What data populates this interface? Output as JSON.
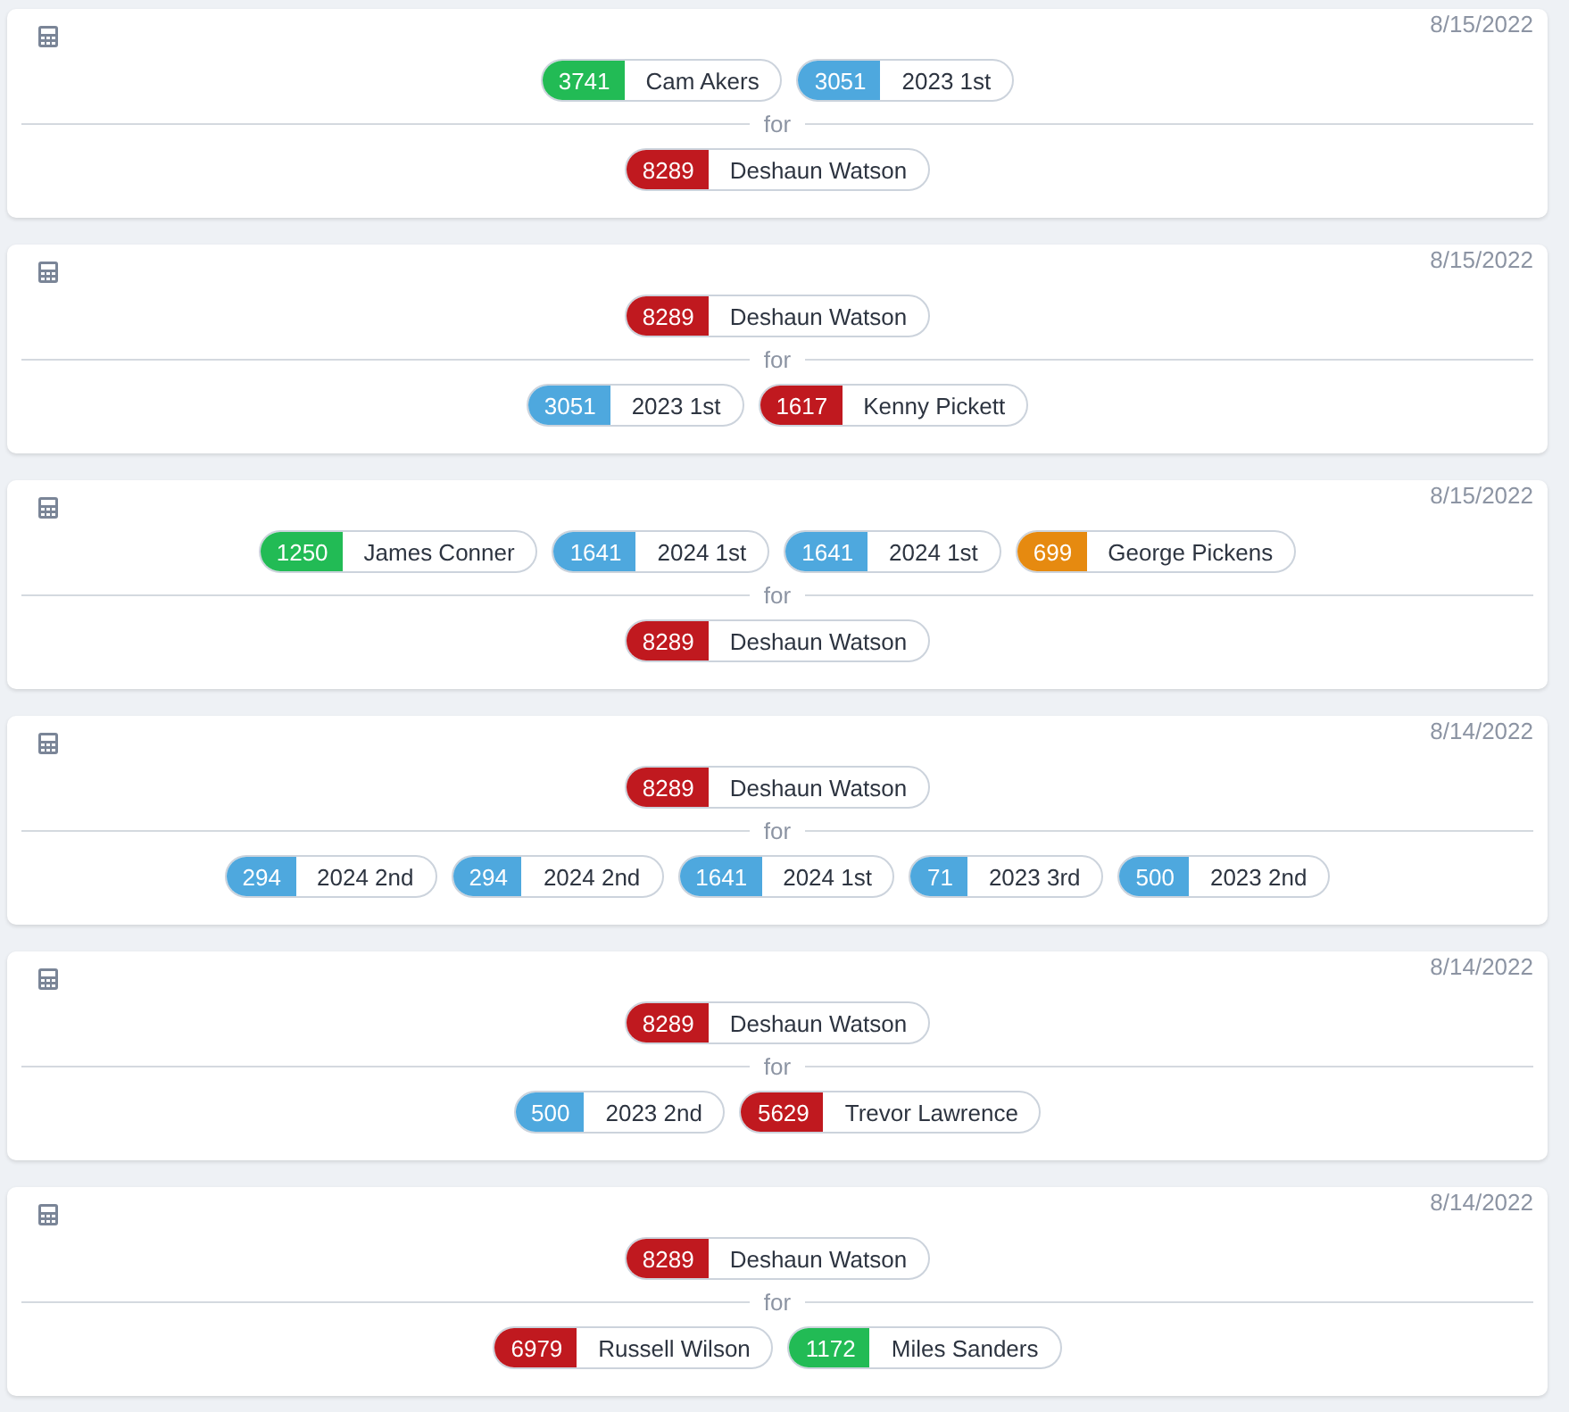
{
  "trades": [
    {
      "date": "8/15/2022",
      "give": [
        {
          "value": "3741",
          "name": "Cam Akers",
          "color": "#22bb55"
        },
        {
          "value": "3051",
          "name": "2023 1st",
          "color": "#4ea8de"
        }
      ],
      "separator": "for",
      "get": [
        {
          "value": "8289",
          "name": "Deshaun Watson",
          "color": "#c0191f"
        }
      ]
    },
    {
      "date": "8/15/2022",
      "give": [
        {
          "value": "8289",
          "name": "Deshaun Watson",
          "color": "#c0191f"
        }
      ],
      "separator": "for",
      "get": [
        {
          "value": "3051",
          "name": "2023 1st",
          "color": "#4ea8de"
        },
        {
          "value": "1617",
          "name": "Kenny Pickett",
          "color": "#c0191f"
        }
      ]
    },
    {
      "date": "8/15/2022",
      "give": [
        {
          "value": "1250",
          "name": "James Conner",
          "color": "#22bb55"
        },
        {
          "value": "1641",
          "name": "2024 1st",
          "color": "#4ea8de"
        },
        {
          "value": "1641",
          "name": "2024 1st",
          "color": "#4ea8de"
        },
        {
          "value": "699",
          "name": "George Pickens",
          "color": "#e68a10"
        }
      ],
      "separator": "for",
      "get": [
        {
          "value": "8289",
          "name": "Deshaun Watson",
          "color": "#c0191f"
        }
      ]
    },
    {
      "date": "8/14/2022",
      "give": [
        {
          "value": "8289",
          "name": "Deshaun Watson",
          "color": "#c0191f"
        }
      ],
      "separator": "for",
      "get": [
        {
          "value": "294",
          "name": "2024 2nd",
          "color": "#4ea8de"
        },
        {
          "value": "294",
          "name": "2024 2nd",
          "color": "#4ea8de"
        },
        {
          "value": "1641",
          "name": "2024 1st",
          "color": "#4ea8de"
        },
        {
          "value": "71",
          "name": "2023 3rd",
          "color": "#4ea8de"
        },
        {
          "value": "500",
          "name": "2023 2nd",
          "color": "#4ea8de"
        }
      ]
    },
    {
      "date": "8/14/2022",
      "give": [
        {
          "value": "8289",
          "name": "Deshaun Watson",
          "color": "#c0191f"
        }
      ],
      "separator": "for",
      "get": [
        {
          "value": "500",
          "name": "2023 2nd",
          "color": "#4ea8de"
        },
        {
          "value": "5629",
          "name": "Trevor Lawrence",
          "color": "#c0191f"
        }
      ]
    },
    {
      "date": "8/14/2022",
      "give": [
        {
          "value": "8289",
          "name": "Deshaun Watson",
          "color": "#c0191f"
        }
      ],
      "separator": "for",
      "get": [
        {
          "value": "6979",
          "name": "Russell Wilson",
          "color": "#c0191f"
        },
        {
          "value": "1172",
          "name": "Miles Sanders",
          "color": "#22bb55"
        }
      ]
    }
  ]
}
